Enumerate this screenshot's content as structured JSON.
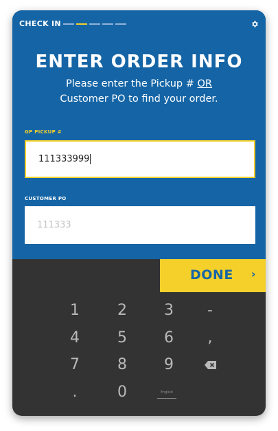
{
  "header": {
    "section_label": "CHECK IN",
    "progress": {
      "total_steps": 5,
      "current_step": 2
    }
  },
  "title": "ENTER ORDER INFO",
  "subtitle": {
    "before": "Please enter the Pickup # ",
    "or": "OR",
    "after": " Customer PO to find your order."
  },
  "fields": {
    "pickup": {
      "label": "GP PICKUP #",
      "value": "111333999"
    },
    "customer_po": {
      "label": "CUSTOMER PO",
      "placeholder": "111333"
    }
  },
  "done_button": {
    "label": "DONE",
    "chevron": "›"
  },
  "keypad": {
    "keys": [
      "1",
      "2",
      "3",
      "-",
      "4",
      "5",
      "6",
      ",",
      "7",
      "8",
      "9",
      ".",
      "0"
    ],
    "language": "English"
  },
  "colors": {
    "primary": "#1565a6",
    "accent": "#f5d02a",
    "keyboard": "#333333"
  },
  "icons": {
    "settings": "gear-icon",
    "delete": "backspace-icon"
  }
}
